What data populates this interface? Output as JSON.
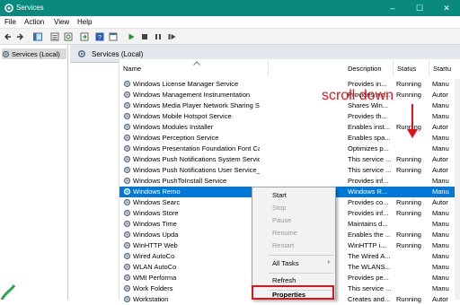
{
  "window": {
    "title": "Services",
    "min": "–",
    "max": "☐",
    "close": "✕"
  },
  "menu": [
    "File",
    "Action",
    "View",
    "Help"
  ],
  "tree": {
    "root_label": "Services (Local)"
  },
  "pane_header": "Services (Local)",
  "columns": {
    "name": "Name",
    "description": "Description",
    "status": "Status",
    "startup": "Startu"
  },
  "rows": [
    {
      "name": "Windows License Manager Service",
      "desc": "Provides in...",
      "status": "Running",
      "startup": "Manu"
    },
    {
      "name": "Windows Management Instrumentation",
      "desc": "Provides a c...",
      "status": "Running",
      "startup": "Autor"
    },
    {
      "name": "Windows Media Player Network Sharing Service",
      "desc": "Shares Win...",
      "status": "",
      "startup": "Manu"
    },
    {
      "name": "Windows Mobile Hotspot Service",
      "desc": "Provides th...",
      "status": "",
      "startup": "Manu"
    },
    {
      "name": "Windows Modules Installer",
      "desc": "Enables inst...",
      "status": "Running",
      "startup": "Autor"
    },
    {
      "name": "Windows Perception Service",
      "desc": "Enables spa...",
      "status": "",
      "startup": "Manu"
    },
    {
      "name": "Windows Presentation Foundation Font Ca...",
      "desc": "Optimizes p...",
      "status": "",
      "startup": "Manu"
    },
    {
      "name": "Windows Push Notifications System Service",
      "desc": "This service ...",
      "status": "Running",
      "startup": "Autor"
    },
    {
      "name": "Windows Push Notifications User Service_6...",
      "desc": "This service ...",
      "status": "Running",
      "startup": "Autor"
    },
    {
      "name": "Windows PushToInstall Service",
      "desc": "Provides inf...",
      "status": "",
      "startup": "Manu"
    },
    {
      "name": "Windows Remo",
      "desc": "Windows R...",
      "status": "",
      "startup": "Manu"
    },
    {
      "name": "Windows Searc",
      "desc": "Provides co...",
      "status": "Running",
      "startup": "Autor"
    },
    {
      "name": "Windows Store",
      "desc": "Provides inf...",
      "status": "Running",
      "startup": "Manu"
    },
    {
      "name": "Windows Time",
      "desc": "Maintains d...",
      "status": "",
      "startup": "Manu"
    },
    {
      "name": "Windows Upda",
      "desc": "Enables the ...",
      "status": "Running",
      "startup": "Manu"
    },
    {
      "name": "WinHTTP Web",
      "desc": "WinHTTP i...",
      "status": "Running",
      "startup": "Manu"
    },
    {
      "name": "Wired AutoCo",
      "desc": "The Wired A...",
      "status": "",
      "startup": "Manu"
    },
    {
      "name": "WLAN AutoCo",
      "desc": "The WLANS...",
      "status": "",
      "startup": "Manu"
    },
    {
      "name": "WMI Performa",
      "desc": "Provides pe...",
      "status": "",
      "startup": "Manu"
    },
    {
      "name": "Work Folders",
      "desc": "This service ...",
      "status": "",
      "startup": "Manu"
    },
    {
      "name": "Workstation",
      "desc": "Creates and...",
      "status": "Running",
      "startup": "Autor"
    }
  ],
  "annotation": {
    "text": "scroll down",
    "color": "#e0131d"
  },
  "context_menu": {
    "start": "Start",
    "stop": "Stop",
    "pause": "Pause",
    "resume": "Resume",
    "restart": "Restart",
    "all_tasks": "All Tasks",
    "refresh": "Refresh",
    "properties": "Properties",
    "submenu_arrow": "›"
  },
  "colors": {
    "titlebar": "#0a8a7e",
    "selection": "#0078d7",
    "highlight_box": "#e0131d"
  }
}
